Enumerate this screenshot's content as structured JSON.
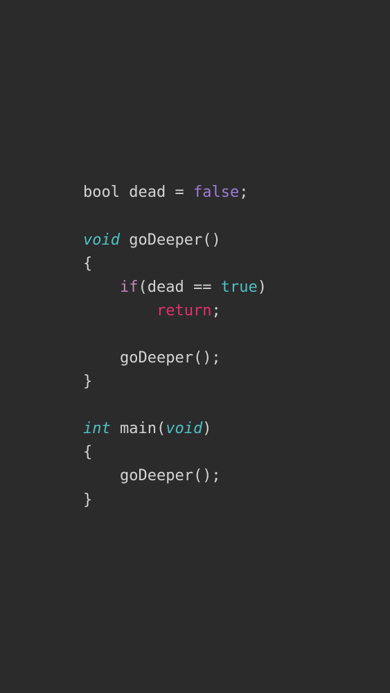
{
  "code": {
    "line1": {
      "type": "bool",
      "space1": " ",
      "ident": "dead",
      "space2": " ",
      "op": "=",
      "space3": " ",
      "literal": "false",
      "semi": ";"
    },
    "line2_blank": "",
    "line3": {
      "type": "void",
      "space": " ",
      "fn": "goDeeper",
      "parens": "()"
    },
    "line4": "{",
    "line5": {
      "indent": "    ",
      "if": "if",
      "open": "(",
      "ident": "dead",
      "space1": " ",
      "op": "==",
      "space2": " ",
      "literal": "true",
      "close": ")"
    },
    "line6": {
      "indent": "        ",
      "return": "return",
      "semi": ";"
    },
    "line7_blank": "",
    "line8": {
      "indent": "    ",
      "call": "goDeeper();"
    },
    "line9": "}",
    "line10_blank": "",
    "line11": {
      "type": "int",
      "space": " ",
      "fn": "main",
      "open": "(",
      "param": "void",
      "close": ")"
    },
    "line12": "{",
    "line13": {
      "indent": "    ",
      "call": "goDeeper();"
    },
    "line14": "}"
  }
}
